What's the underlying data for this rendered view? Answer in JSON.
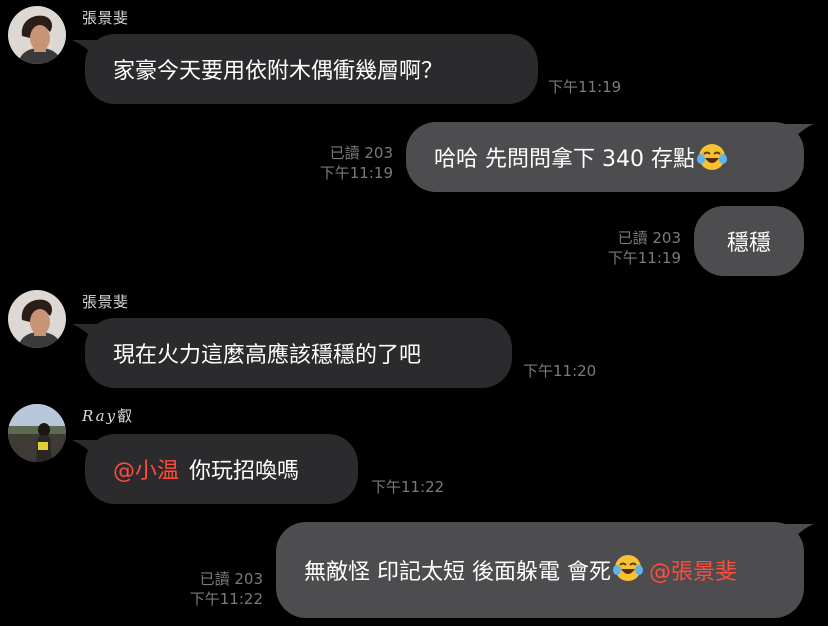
{
  "messages": [
    {
      "sender": "張景斐",
      "text": "家豪今天要用依附木偶衝幾層啊？",
      "time": "下午11:19"
    },
    {
      "read": "已讀 203",
      "time": "下午11:19",
      "text": "哈哈 先問問拿下 340 存點",
      "emoji": "face-with-tears-of-joy"
    },
    {
      "read": "已讀 203",
      "time": "下午11:19",
      "text": "穩穩"
    },
    {
      "sender": "張景斐",
      "text": "現在火力這麼高應該穩穩的了吧",
      "time": "下午11:20"
    },
    {
      "sender": "Ray",
      "sender_suffix": "叡",
      "mention": "@小温",
      "text": "你玩招喚嗎",
      "time": "下午11:22"
    },
    {
      "read": "已讀 203",
      "time": "下午11:22",
      "text": "無敵怪 印記太短  後面躲電 會死",
      "emoji": "face-with-tears-of-joy",
      "mention": "@張景斐"
    }
  ],
  "colors": {
    "background": "#000000",
    "incoming_bubble": "#2b2b2d",
    "outgoing_bubble": "#4d4d50",
    "mention": "#ff4c3b",
    "meta_text": "#7a7a7e"
  }
}
